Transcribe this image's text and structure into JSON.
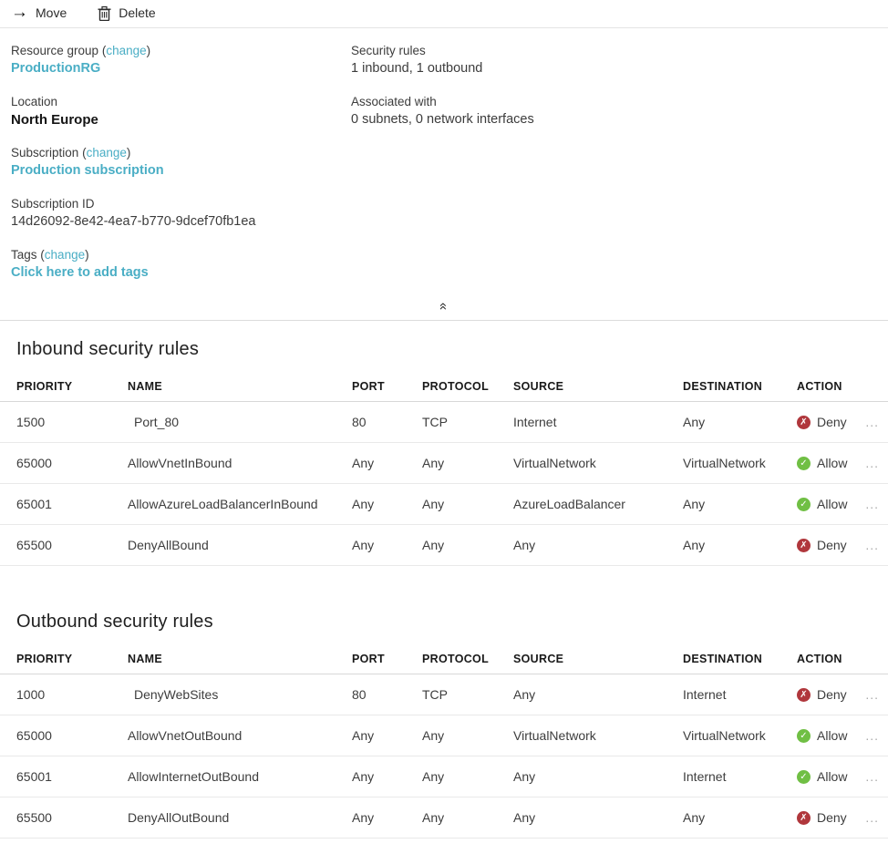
{
  "toolbar": {
    "move": "Move",
    "delete": "Delete"
  },
  "overview": {
    "resource_group_label": "Resource group",
    "change_label": "change",
    "resource_group_value": "ProductionRG",
    "location_label": "Location",
    "location_value": "North Europe",
    "subscription_label": "Subscription",
    "subscription_value": "Production subscription",
    "subscription_id_label": "Subscription ID",
    "subscription_id_value": "14d26092-8e42-4ea7-b770-9dcef70fb1ea",
    "tags_label": "Tags",
    "tags_value": "Click here to add tags",
    "security_rules_label": "Security rules",
    "security_rules_value": "1 inbound, 1 outbound",
    "associated_with_label": "Associated with",
    "associated_with_value": "0 subnets, 0 network interfaces"
  },
  "columns": {
    "priority": "PRIORITY",
    "name": "NAME",
    "port": "PORT",
    "protocol": "PROTOCOL",
    "source": "SOURCE",
    "destination": "DESTINATION",
    "action": "ACTION"
  },
  "inbound": {
    "title": "Inbound security rules",
    "rows": [
      {
        "priority": "1500",
        "name": "Port_80",
        "port": "80",
        "protocol": "TCP",
        "source": "Internet",
        "destination": "Any",
        "action": "Deny"
      },
      {
        "priority": "65000",
        "name": "AllowVnetInBound",
        "port": "Any",
        "protocol": "Any",
        "source": "VirtualNetwork",
        "destination": "VirtualNetwork",
        "action": "Allow"
      },
      {
        "priority": "65001",
        "name": "AllowAzureLoadBalancerInBound",
        "port": "Any",
        "protocol": "Any",
        "source": "AzureLoadBalancer",
        "destination": "Any",
        "action": "Allow"
      },
      {
        "priority": "65500",
        "name": "DenyAllBound",
        "port": "Any",
        "protocol": "Any",
        "source": "Any",
        "destination": "Any",
        "action": "Deny"
      }
    ]
  },
  "outbound": {
    "title": "Outbound security rules",
    "rows": [
      {
        "priority": "1000",
        "name": "DenyWebSites",
        "port": "80",
        "protocol": "TCP",
        "source": "Any",
        "destination": "Internet",
        "action": "Deny"
      },
      {
        "priority": "65000",
        "name": "AllowVnetOutBound",
        "port": "Any",
        "protocol": "Any",
        "source": "VirtualNetwork",
        "destination": "VirtualNetwork",
        "action": "Allow"
      },
      {
        "priority": "65001",
        "name": "AllowInternetOutBound",
        "port": "Any",
        "protocol": "Any",
        "source": "Any",
        "destination": "Internet",
        "action": "Allow"
      },
      {
        "priority": "65500",
        "name": "DenyAllOutBound",
        "port": "Any",
        "protocol": "Any",
        "source": "Any",
        "destination": "Any",
        "action": "Deny"
      }
    ]
  },
  "more_label": "...",
  "icons": {
    "move": "arrow-right-icon",
    "delete": "trash-icon",
    "collapse": "double-chevron-up-icon",
    "allow": "check-circle-icon",
    "deny": "x-circle-icon"
  },
  "colors": {
    "link_teal": "#4aaec5",
    "allow_green": "#70bf44",
    "deny_red": "#b0373c",
    "heading_text": "#1f1f1f",
    "body_text": "#3d3d3d",
    "divider": "#e9e9e9"
  }
}
